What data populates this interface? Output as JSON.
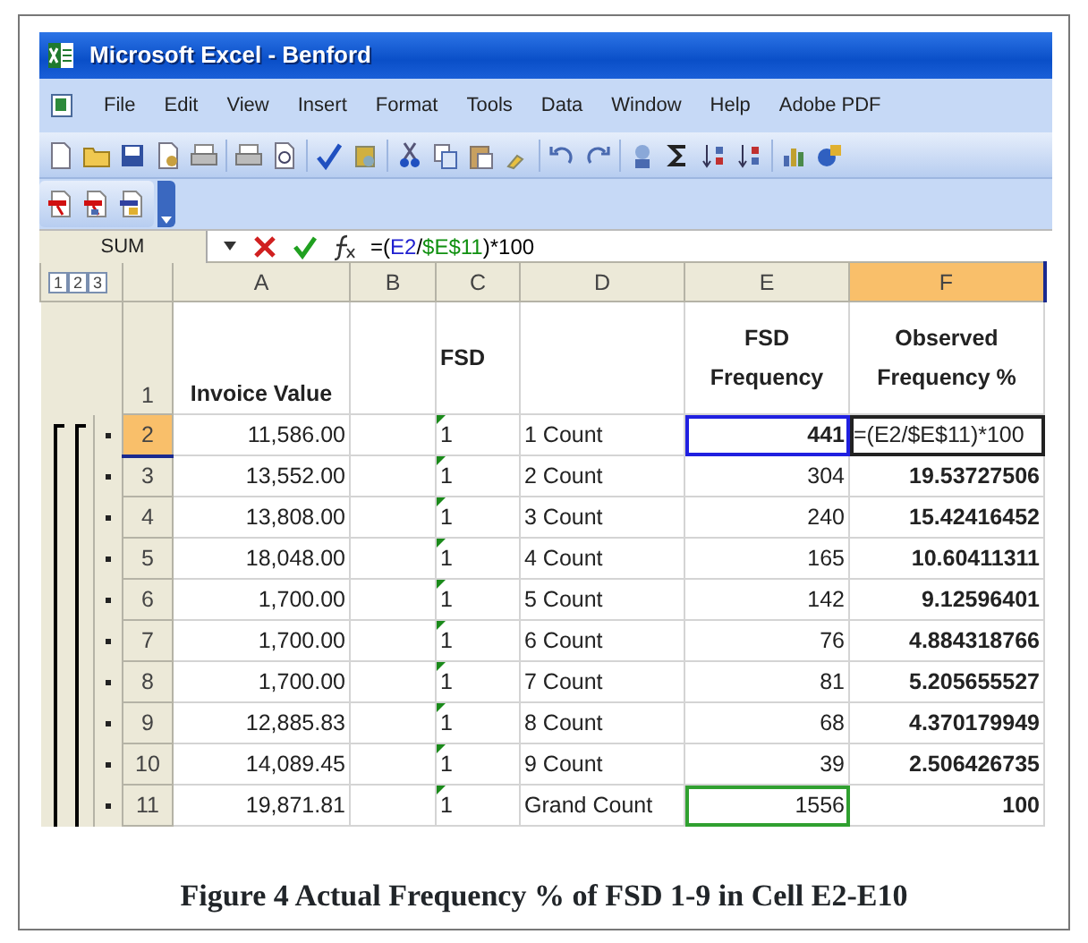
{
  "window": {
    "title": "Microsoft Excel - Benford"
  },
  "menu": [
    "File",
    "Edit",
    "View",
    "Insert",
    "Format",
    "Tools",
    "Data",
    "Window",
    "Help",
    "Adobe PDF"
  ],
  "formula_bar": {
    "name_box": "SUM",
    "formula_parts": [
      {
        "text": "=(",
        "color": "#000000"
      },
      {
        "text": "E2",
        "color": "#2020d0"
      },
      {
        "text": "/",
        "color": "#000000"
      },
      {
        "text": "$E$11",
        "color": "#109010"
      },
      {
        "text": ")*100",
        "color": "#000000"
      }
    ]
  },
  "outline_levels": [
    "1",
    "2",
    "3"
  ],
  "columns": [
    {
      "label": "A",
      "selected": false,
      "kind": "number"
    },
    {
      "label": "B",
      "selected": false,
      "kind": "text"
    },
    {
      "label": "C",
      "selected": false,
      "kind": "flagged"
    },
    {
      "label": "D",
      "selected": false,
      "kind": "text"
    },
    {
      "label": "E",
      "selected": false,
      "kind": "number"
    },
    {
      "label": "F",
      "selected": true,
      "kind": "emphasis"
    }
  ],
  "header_row": {
    "number": "1",
    "cells": [
      "Invoice Value",
      "",
      "FSD",
      "",
      "FSD Frequency",
      "Observed Frequency %"
    ]
  },
  "rows": [
    {
      "number": "2",
      "selected": true,
      "cells": [
        "11,586.00",
        "",
        "1",
        "1 Count",
        {
          "text": "441",
          "color": "#2020e0"
        },
        {
          "text": "=(E2/$E$11)*100",
          "editing": true
        }
      ]
    },
    {
      "number": "3",
      "selected": false,
      "cells": [
        "13,552.00",
        "",
        "1",
        "2 Count",
        "304",
        "19.53727506"
      ]
    },
    {
      "number": "4",
      "selected": false,
      "cells": [
        "13,808.00",
        "",
        "1",
        "3 Count",
        "240",
        "15.42416452"
      ]
    },
    {
      "number": "5",
      "selected": false,
      "cells": [
        "18,048.00",
        "",
        "1",
        "4 Count",
        "165",
        "10.60411311"
      ]
    },
    {
      "number": "6",
      "selected": false,
      "cells": [
        "1,700.00",
        "",
        "1",
        "5 Count",
        "142",
        "9.12596401"
      ]
    },
    {
      "number": "7",
      "selected": false,
      "cells": [
        "1,700.00",
        "",
        "1",
        "6 Count",
        "76",
        "4.884318766"
      ]
    },
    {
      "number": "8",
      "selected": false,
      "cells": [
        "1,700.00",
        "",
        "1",
        "7 Count",
        "81",
        "5.205655527"
      ]
    },
    {
      "number": "9",
      "selected": false,
      "cells": [
        "12,885.83",
        "",
        "1",
        "8 Count",
        "68",
        "4.370179949"
      ]
    },
    {
      "number": "10",
      "selected": false,
      "cells": [
        "14,089.45",
        "",
        "1",
        "9 Count",
        "39",
        "2.506426735"
      ]
    },
    {
      "number": "11",
      "selected": false,
      "cells": [
        "19,871.81",
        "",
        "1",
        "Grand Count",
        {
          "text": "1556",
          "color": "#30a030"
        },
        "100"
      ]
    }
  ],
  "caption": "Figure 4 Actual Frequency % of FSD 1-9 in Cell E2-E10"
}
